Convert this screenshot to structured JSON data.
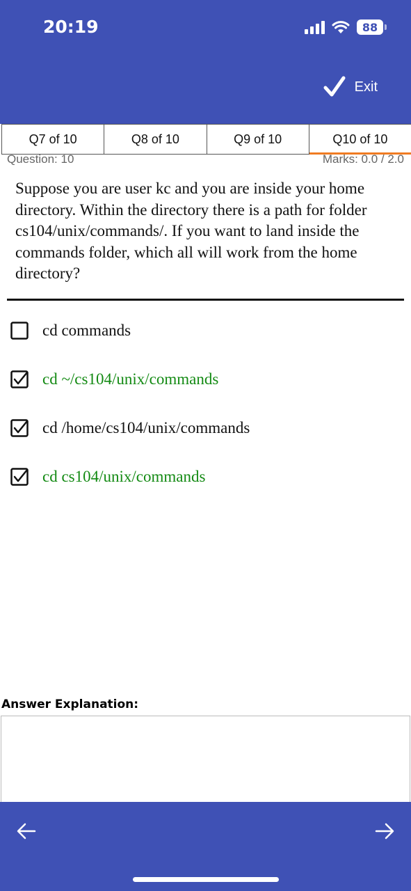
{
  "status_bar": {
    "time": "20:19",
    "battery": "88"
  },
  "header": {
    "exit_label": "Exit"
  },
  "tabs": [
    {
      "label": "Q7 of 10",
      "active": false
    },
    {
      "label": "Q8 of 10",
      "active": false
    },
    {
      "label": "Q9 of 10",
      "active": false
    },
    {
      "label": "Q10 of 10",
      "active": true
    }
  ],
  "question": {
    "number_label": "Question: 10",
    "marks_label": "Marks: 0.0 / 2.0",
    "text": "Suppose you are user kc and you are inside your home directory. Within the directory there is a path for folder cs104/unix/commands/. If you want to land inside the commands folder, which all will work from the home directory?"
  },
  "options": [
    {
      "text": "cd commands",
      "checked": false,
      "correct": false
    },
    {
      "text": "cd ~/cs104/unix/commands",
      "checked": true,
      "correct": true
    },
    {
      "text": "cd /home/cs104/unix/commands",
      "checked": true,
      "correct": false
    },
    {
      "text": "cd cs104/unix/commands",
      "checked": true,
      "correct": true
    }
  ],
  "explanation": {
    "label": "Answer Explanation:",
    "text": ""
  },
  "colors": {
    "primary": "#3f51b5",
    "accent": "#f07b22",
    "correct": "#138a13"
  },
  "icons": {
    "exit": "checkmark-icon",
    "prev": "arrow-left-icon",
    "next": "arrow-right-icon"
  }
}
